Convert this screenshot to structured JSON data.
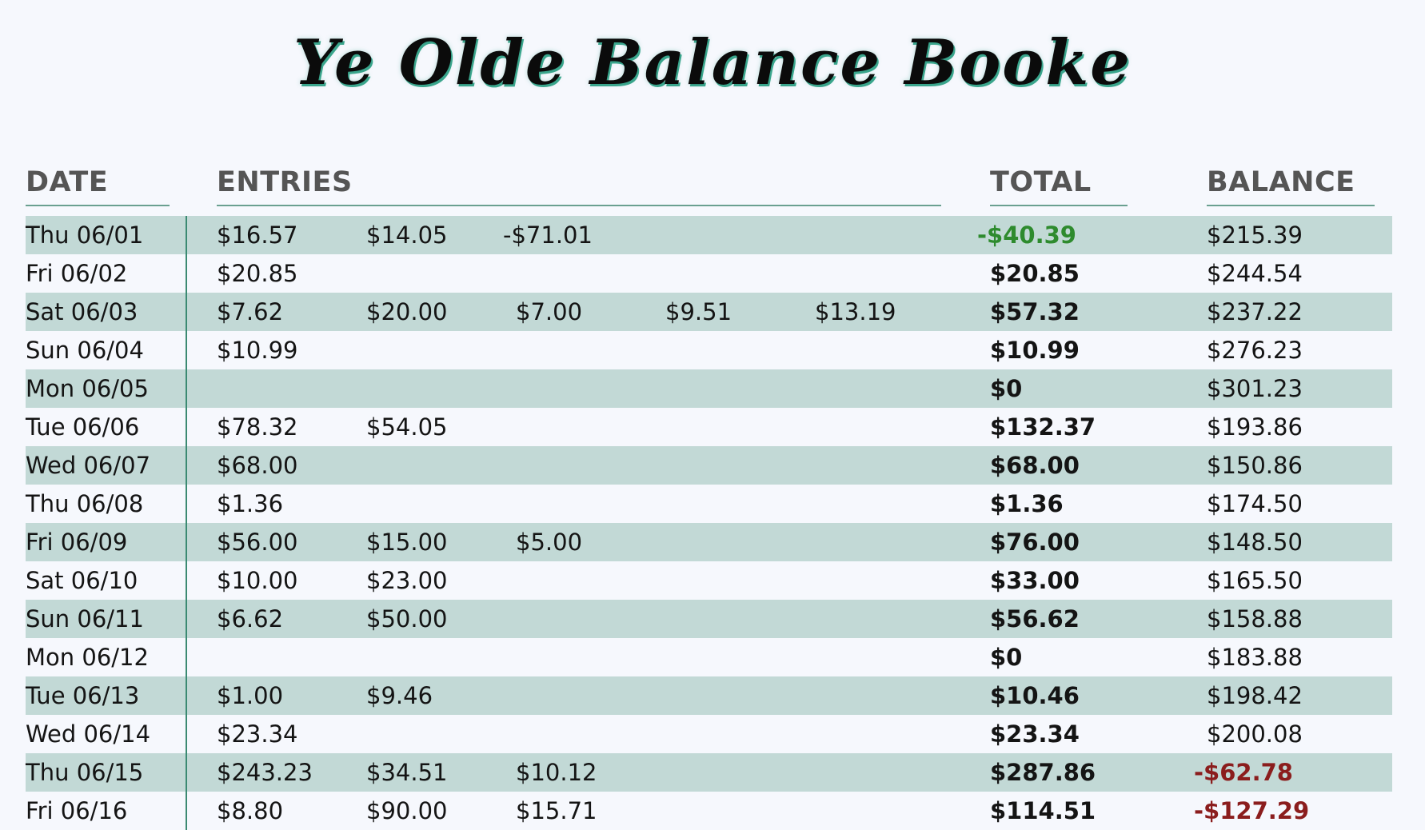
{
  "title": "Ye Olde Balance Booke",
  "headers": {
    "date": "DATE",
    "entries": "ENTRIES",
    "total": "TOTAL",
    "balance": "BALANCE"
  },
  "colors": {
    "row_shade": "#c2d9d6",
    "divider": "#3b8a72",
    "negative_total": "#2e8b2e",
    "negative_balance": "#8b1d1d"
  },
  "rows": [
    {
      "date": "Thu 06/01",
      "entries": [
        "$16.57",
        "$14.05",
        "-$71.01"
      ],
      "total": "-$40.39",
      "balance": "$215.39",
      "total_negative": true,
      "balance_negative": false
    },
    {
      "date": "Fri 06/02",
      "entries": [
        "$20.85"
      ],
      "total": "$20.85",
      "balance": "$244.54",
      "total_negative": false,
      "balance_negative": false
    },
    {
      "date": "Sat 06/03",
      "entries": [
        "$7.62",
        "$20.00",
        "$7.00",
        "$9.51",
        "$13.19"
      ],
      "total": "$57.32",
      "balance": "$237.22",
      "total_negative": false,
      "balance_negative": false
    },
    {
      "date": "Sun 06/04",
      "entries": [
        "$10.99"
      ],
      "total": "$10.99",
      "balance": "$276.23",
      "total_negative": false,
      "balance_negative": false
    },
    {
      "date": "Mon 06/05",
      "entries": [],
      "total": "$0",
      "balance": "$301.23",
      "total_negative": false,
      "balance_negative": false
    },
    {
      "date": "Tue 06/06",
      "entries": [
        "$78.32",
        "$54.05"
      ],
      "total": "$132.37",
      "balance": "$193.86",
      "total_negative": false,
      "balance_negative": false
    },
    {
      "date": "Wed 06/07",
      "entries": [
        "$68.00"
      ],
      "total": "$68.00",
      "balance": "$150.86",
      "total_negative": false,
      "balance_negative": false
    },
    {
      "date": "Thu 06/08",
      "entries": [
        "$1.36"
      ],
      "total": "$1.36",
      "balance": "$174.50",
      "total_negative": false,
      "balance_negative": false
    },
    {
      "date": "Fri 06/09",
      "entries": [
        "$56.00",
        "$15.00",
        "$5.00"
      ],
      "total": "$76.00",
      "balance": "$148.50",
      "total_negative": false,
      "balance_negative": false
    },
    {
      "date": "Sat 06/10",
      "entries": [
        "$10.00",
        "$23.00"
      ],
      "total": "$33.00",
      "balance": "$165.50",
      "total_negative": false,
      "balance_negative": false
    },
    {
      "date": "Sun 06/11",
      "entries": [
        "$6.62",
        "$50.00"
      ],
      "total": "$56.62",
      "balance": "$158.88",
      "total_negative": false,
      "balance_negative": false
    },
    {
      "date": "Mon 06/12",
      "entries": [],
      "total": "$0",
      "balance": "$183.88",
      "total_negative": false,
      "balance_negative": false
    },
    {
      "date": "Tue 06/13",
      "entries": [
        "$1.00",
        "$9.46"
      ],
      "total": "$10.46",
      "balance": "$198.42",
      "total_negative": false,
      "balance_negative": false
    },
    {
      "date": "Wed 06/14",
      "entries": [
        "$23.34"
      ],
      "total": "$23.34",
      "balance": "$200.08",
      "total_negative": false,
      "balance_negative": false
    },
    {
      "date": "Thu 06/15",
      "entries": [
        "$243.23",
        "$34.51",
        "$10.12"
      ],
      "total": "$287.86",
      "balance": "-$62.78",
      "total_negative": false,
      "balance_negative": true
    },
    {
      "date": "Fri 06/16",
      "entries": [
        "$8.80",
        "$90.00",
        "$15.71"
      ],
      "total": "$114.51",
      "balance": "-$127.29",
      "total_negative": false,
      "balance_negative": true
    }
  ]
}
